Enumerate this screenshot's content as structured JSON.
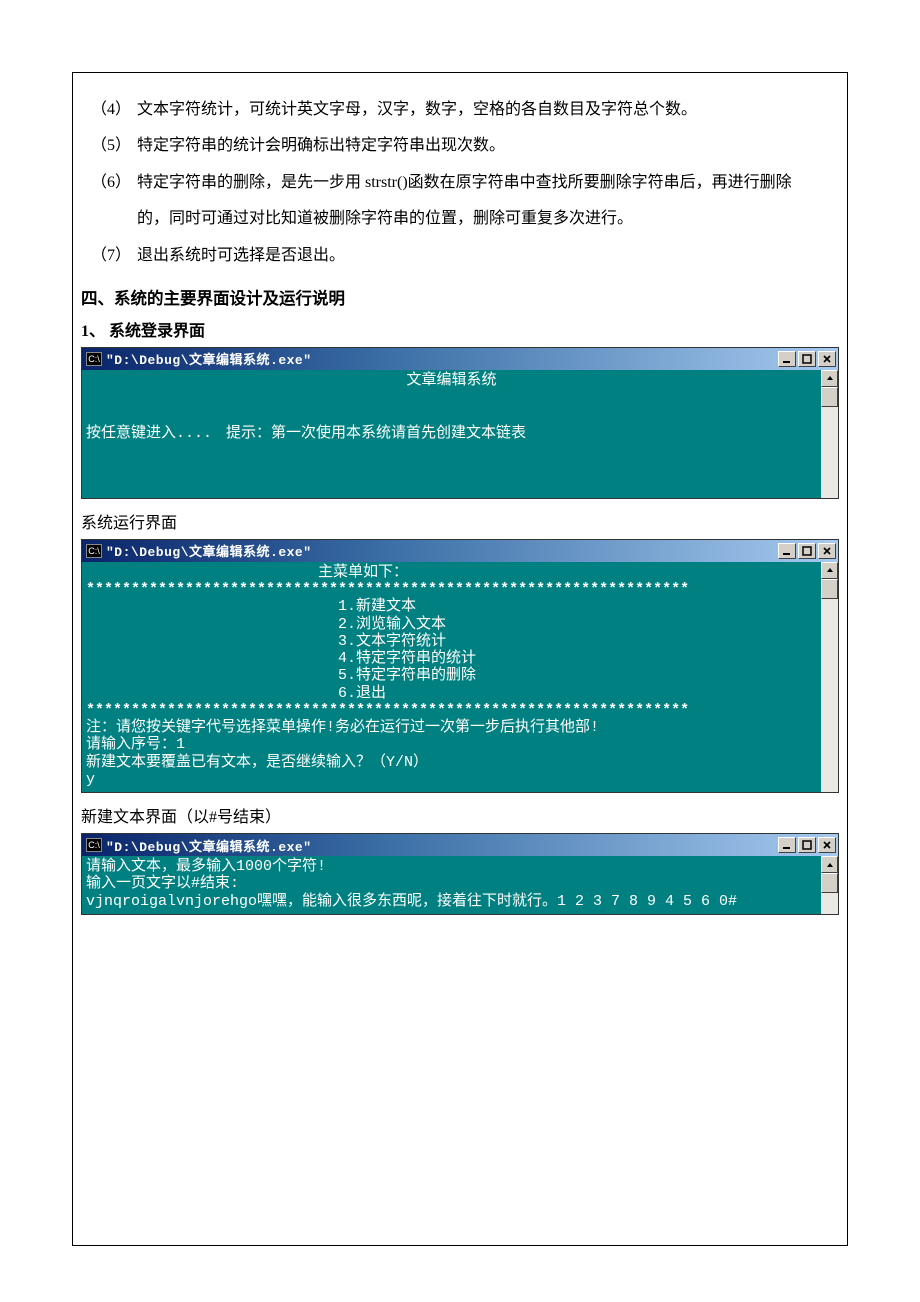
{
  "list": {
    "i4": {
      "num": "（4）",
      "text": "文本字符统计，可统计英文字母，汉字，数字，空格的各自数目及字符总个数。"
    },
    "i5": {
      "num": "（5）",
      "text": "特定字符串的统计会明确标出特定字符串出现次数。"
    },
    "i6": {
      "num": "（6）",
      "text": "特定字符串的删除，是先一步用 strstr()函数在原字符串中查找所要删除字符串后，再进行删除",
      "cont": "的，同时可通过对比知道被删除字符串的位置，删除可重复多次进行。"
    },
    "i7": {
      "num": "（7）",
      "text": "退出系统时可选择是否退出。"
    }
  },
  "section4_title": "四、系统的主要界面设计及运行说明",
  "sub1_title": "1、 系统登录界面",
  "sub2_title": "系统运行界面",
  "sub3_title": "新建文本界面（以#号结束）",
  "window_title": "\"D:\\Debug\\文章编辑系统.exe\"",
  "cmd_label": "C:\\",
  "console1": {
    "title_center": "文章编辑系统",
    "hint": "提示：第一次使用本系统请首先创建文本链表",
    "press": "按任意键进入...."
  },
  "console2": {
    "menu_label": "主菜单如下：",
    "stars": "*******************************************************************",
    "m1": "1.新建文本",
    "m2": "2.浏览输入文本",
    "m3": "3.文本字符统计",
    "m4": "4.特定字符串的统计",
    "m5": "5.特定字符串的删除",
    "m6": "6.退出",
    "note": "注：请您按关键字代号选择菜单操作!务必在运行过一次第一步后执行其他部!",
    "prompt_seq": "请输入序号：1",
    "prompt_over": "新建文本要覆盖已有文本，是否继续输入？（Y/N）",
    "answer": "y"
  },
  "console3": {
    "l1": "请输入文本，最多输入1000个字符!",
    "l2": "输入一页文字以#结束:",
    "l3": "vjnqroigalvnjorehgo嘿嘿，能输入很多东西呢，接着往下时就行。1 2 3 7 8 9 4 5 6 0#"
  }
}
